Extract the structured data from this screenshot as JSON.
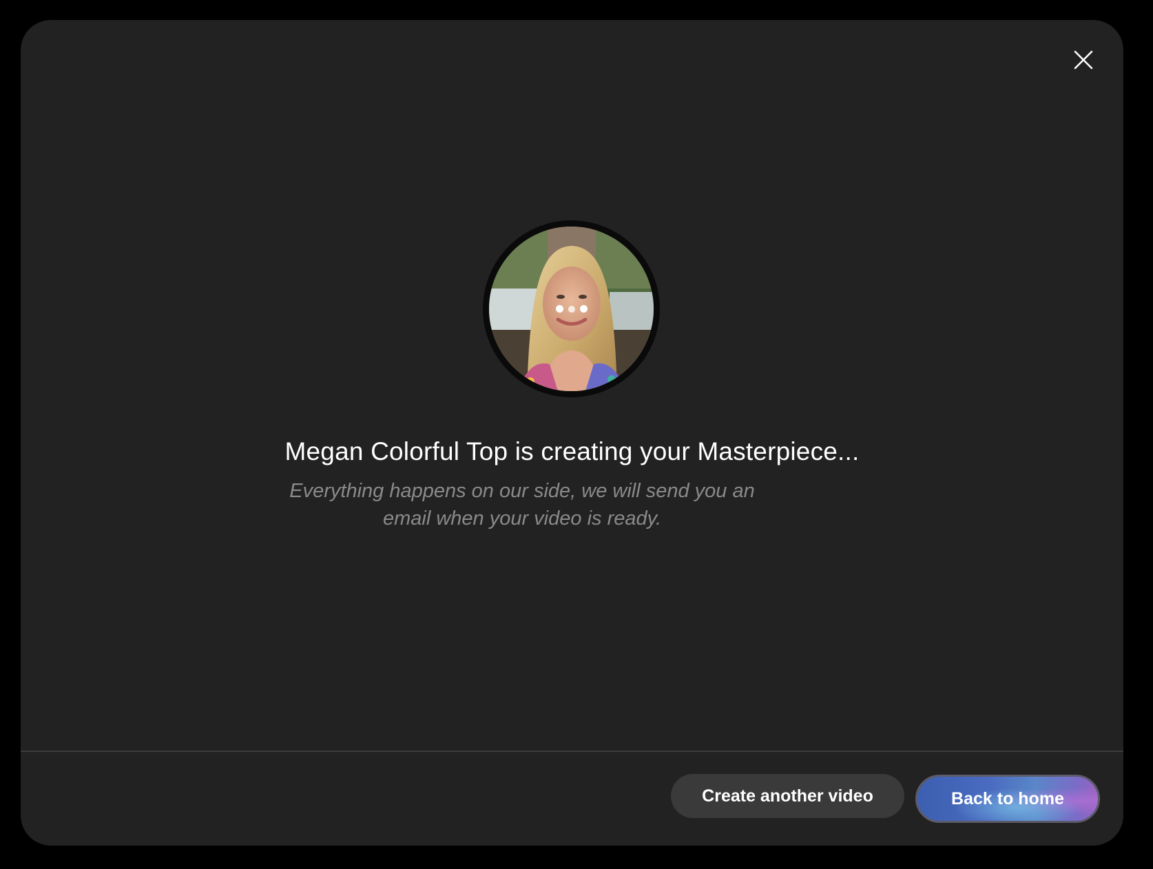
{
  "modal": {
    "title": "Megan Colorful Top is creating your Masterpiece...",
    "subtitle": "Everything happens on our side, we will send you an email when your video is ready.",
    "close_icon": "close-icon",
    "avatar_icon": "avatar-photo",
    "loading_icon": "loading-dots-icon"
  },
  "footer": {
    "secondary_label": "Create another video",
    "primary_label": "Back to home"
  },
  "colors": {
    "background": "#000000",
    "modal": "#222222",
    "secondary_button": "#3a3a3a",
    "primary_gradient_start": "#3c5fb0",
    "primary_gradient_end": "#9a62c0",
    "subtitle_text": "#8a8a8a"
  }
}
